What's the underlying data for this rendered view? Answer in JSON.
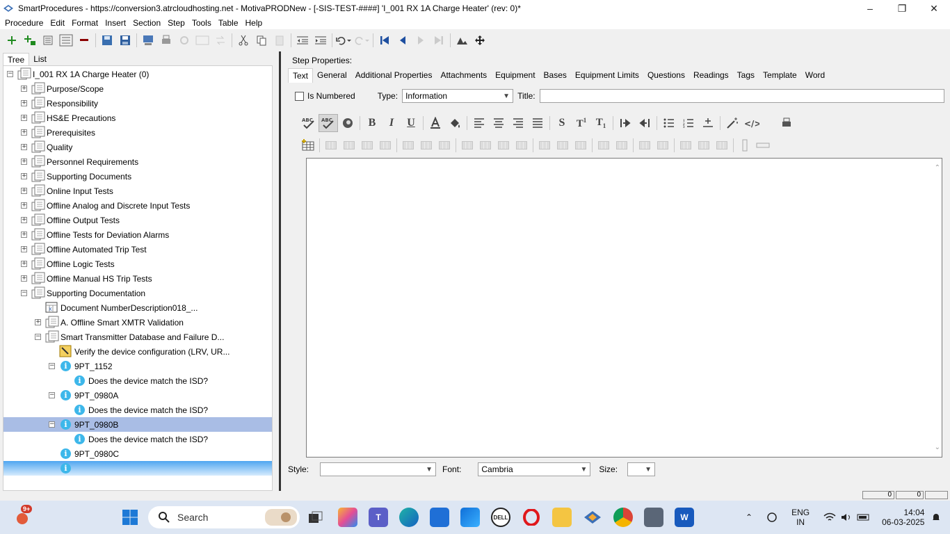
{
  "window": {
    "title": "SmartProcedures - https://conversion3.atrcloudhosting.net - MotivaPRODNew - [-SIS-TEST-####] 'I_001 RX 1A Charge Heater' (rev: 0)*",
    "minimize": "–",
    "maximize": "❐",
    "close": "✕"
  },
  "menu": [
    "Procedure",
    "Edit",
    "Format",
    "Insert",
    "Section",
    "Step",
    "Tools",
    "Table",
    "Help"
  ],
  "left_tabs": [
    "Tree",
    "List"
  ],
  "tree": [
    {
      "label": "I_001 RX 1A Charge Heater (0)",
      "level": 0,
      "expander": "minus",
      "icon": "page-stack"
    },
    {
      "label": "Purpose/Scope",
      "level": 1,
      "expander": "plus",
      "icon": "page-stack"
    },
    {
      "label": "Responsibility",
      "level": 1,
      "expander": "plus",
      "icon": "page-stack"
    },
    {
      "label": "HS&E Precautions",
      "level": 1,
      "expander": "plus",
      "icon": "page-stack"
    },
    {
      "label": "Prerequisites",
      "level": 1,
      "expander": "plus",
      "icon": "page-stack"
    },
    {
      "label": "Quality",
      "level": 1,
      "expander": "plus",
      "icon": "page-stack"
    },
    {
      "label": "Personnel Requirements",
      "level": 1,
      "expander": "plus",
      "icon": "page-stack"
    },
    {
      "label": "Supporting Documents",
      "level": 1,
      "expander": "plus",
      "icon": "page-stack"
    },
    {
      "label": "Online Input Tests",
      "level": 1,
      "expander": "plus",
      "icon": "page-stack"
    },
    {
      "label": "Offline Analog and Discrete Input Tests",
      "level": 1,
      "expander": "plus",
      "icon": "page-stack"
    },
    {
      "label": "Offline Output Tests",
      "level": 1,
      "expander": "plus",
      "icon": "page-stack"
    },
    {
      "label": "Offline Tests for Deviation Alarms",
      "level": 1,
      "expander": "plus",
      "icon": "page-stack"
    },
    {
      "label": "Offline Automated Trip Test",
      "level": 1,
      "expander": "plus",
      "icon": "page-stack"
    },
    {
      "label": "Offline Logic Tests",
      "level": 1,
      "expander": "plus",
      "icon": "page-stack"
    },
    {
      "label": "Offline Manual HS Trip Tests",
      "level": 1,
      "expander": "plus",
      "icon": "page-stack"
    },
    {
      "label": "Supporting Documentation",
      "level": 1,
      "expander": "minus",
      "icon": "page-stack"
    },
    {
      "label": "Document NumberDescription018_...",
      "level": 2,
      "expander": "",
      "icon": "table"
    },
    {
      "label": "A. Offline Smart XMTR Validation",
      "level": 2,
      "expander": "plus",
      "icon": "page-stack"
    },
    {
      "label": "Smart Transmitter Database and Failure D...",
      "level": 2,
      "expander": "minus",
      "icon": "page-stack"
    },
    {
      "label": "Verify the device configuration (LRV, UR...",
      "level": 3,
      "expander": "",
      "icon": "pencil-note"
    },
    {
      "label": "9PT_1152",
      "level": 3,
      "expander": "minus",
      "icon": "info"
    },
    {
      "label": "Does the device match the ISD?",
      "level": 4,
      "expander": "",
      "icon": "info"
    },
    {
      "label": "9PT_0980A",
      "level": 3,
      "expander": "minus",
      "icon": "info"
    },
    {
      "label": "Does the device match the ISD?",
      "level": 4,
      "expander": "",
      "icon": "info"
    },
    {
      "label": "9PT_0980B",
      "level": 3,
      "expander": "minus",
      "icon": "info",
      "selected": true
    },
    {
      "label": "Does the device match the ISD?",
      "level": 4,
      "expander": "",
      "icon": "info"
    },
    {
      "label": "9PT_0980C",
      "level": 3,
      "expander": "",
      "icon": "info"
    },
    {
      "label": "",
      "level": 3,
      "expander": "",
      "icon": "info",
      "editing": true
    }
  ],
  "right": {
    "heading": "Step Properties:",
    "tabs": [
      "Text",
      "General",
      "Additional Properties",
      "Attachments",
      "Equipment",
      "Bases",
      "Equipment Limits",
      "Questions",
      "Readings",
      "Tags",
      "Template",
      "Word"
    ],
    "is_numbered_label": "Is Numbered",
    "is_numbered": false,
    "type_label": "Type:",
    "type_value": "Information",
    "title_label": "Title:",
    "title_value": "",
    "style_label": "Style:",
    "style_value": "",
    "font_label": "Font:",
    "font_value": "Cambria",
    "size_label": "Size:",
    "size_value": ""
  },
  "status": {
    "cell1": "0",
    "cell2": "0"
  },
  "taskbar": {
    "search_placeholder": "Search",
    "notification_badge": "9+",
    "lang_line1": "ENG",
    "lang_line2": "IN",
    "time": "14:04",
    "date": "06-03-2025"
  }
}
